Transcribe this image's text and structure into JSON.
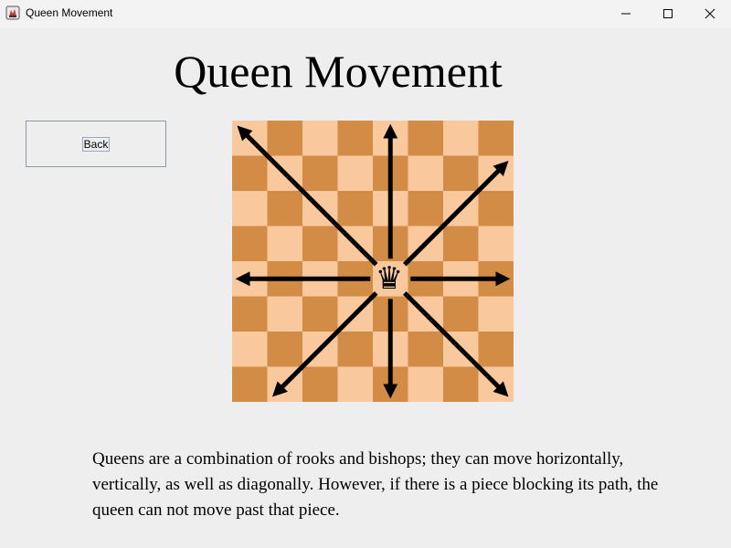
{
  "window": {
    "title": "Queen Movement",
    "icon": "java-app-icon",
    "controls": [
      "minimize-icon",
      "maximize-icon",
      "close-icon"
    ]
  },
  "page": {
    "title": "Queen Movement",
    "back_label": "Back",
    "description": "Queens are a combination of rooks and bishops; they can move horizontally, vertically, as well as diagonally. However, if there is a piece blocking its path, the queen can not move past that piece."
  },
  "board": {
    "size": 8,
    "colors": {
      "light": "#f9c99d",
      "dark": "#d38c46",
      "arrow": "#000000"
    },
    "queen": {
      "glyph": "♛",
      "row": 4,
      "col": 4
    },
    "arrows": [
      "up",
      "down",
      "left",
      "right",
      "up-left",
      "up-right",
      "down-left",
      "down-right"
    ]
  }
}
